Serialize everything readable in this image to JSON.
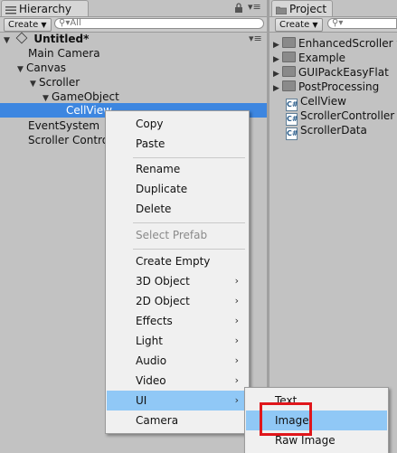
{
  "hierarchy": {
    "tab_label": "Hierarchy",
    "create_label": "Create",
    "search_placeholder": "All",
    "scene_name": "Untitled*",
    "items": [
      {
        "label": "Main Camera"
      },
      {
        "label": "Canvas"
      },
      {
        "label": "Scroller"
      },
      {
        "label": "GameObject"
      },
      {
        "label": "CellView"
      },
      {
        "label": "EventSystem"
      },
      {
        "label": "Scroller Contro"
      }
    ]
  },
  "project": {
    "tab_label": "Project",
    "create_label": "Create",
    "items": [
      {
        "label": "EnhancedScroller v",
        "type": "folder"
      },
      {
        "label": "Example",
        "type": "folder"
      },
      {
        "label": "GUIPackEasyFlat",
        "type": "folder"
      },
      {
        "label": "PostProcessing",
        "type": "folder"
      },
      {
        "label": "CellView",
        "type": "script"
      },
      {
        "label": "ScrollerController",
        "type": "script"
      },
      {
        "label": "ScrollerData",
        "type": "script"
      }
    ]
  },
  "context_menu": {
    "items": [
      {
        "label": "Copy"
      },
      {
        "label": "Paste"
      },
      {
        "label": "Rename"
      },
      {
        "label": "Duplicate"
      },
      {
        "label": "Delete"
      },
      {
        "label": "Select Prefab",
        "disabled": true
      },
      {
        "label": "Create Empty"
      },
      {
        "label": "3D Object",
        "submenu": true
      },
      {
        "label": "2D Object",
        "submenu": true
      },
      {
        "label": "Effects",
        "submenu": true
      },
      {
        "label": "Light",
        "submenu": true
      },
      {
        "label": "Audio",
        "submenu": true
      },
      {
        "label": "Video",
        "submenu": true
      },
      {
        "label": "UI",
        "submenu": true,
        "active": true
      },
      {
        "label": "Camera"
      }
    ]
  },
  "submenu": {
    "items": [
      {
        "label": "Text"
      },
      {
        "label": "Image",
        "active": true
      },
      {
        "label": "Raw Image"
      }
    ]
  },
  "colors": {
    "selection": "#3d86e0",
    "menu_hover": "#90c8f6",
    "highlight_box": "#e0161b"
  }
}
